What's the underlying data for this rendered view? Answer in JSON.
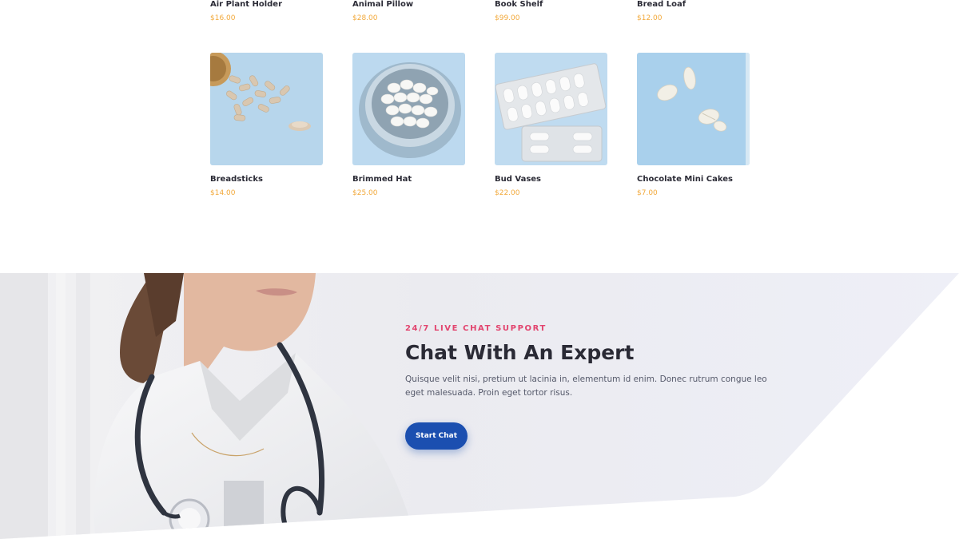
{
  "products": {
    "row_top": [
      {
        "name": "Air Plant Holder",
        "price": "$16.00"
      },
      {
        "name": "Animal Pillow",
        "price": "$28.00"
      },
      {
        "name": "Book Shelf",
        "price": "$99.00"
      },
      {
        "name": "Bread Loaf",
        "price": "$12.00"
      }
    ],
    "row_bottom": [
      {
        "name": "Breadsticks",
        "price": "$14.00"
      },
      {
        "name": "Brimmed Hat",
        "price": "$25.00"
      },
      {
        "name": "Bud Vases",
        "price": "$22.00"
      },
      {
        "name": "Chocolate Mini Cakes",
        "price": "$7.00"
      }
    ]
  },
  "chat": {
    "eyebrow": "24/7 LIVE CHAT SUPPORT",
    "title": "Chat With An Expert",
    "body": "Quisque velit nisi, pretium ut lacinia in, elementum id enim. Donec rutrum congue leo eget malesuada. Proin eget tortor risus.",
    "button_label": "Start Chat"
  },
  "colors": {
    "price": "#f2a93b",
    "eyebrow": "#e2456f",
    "button": "#1b4fb0",
    "heading": "#2a2a35",
    "image_bg": "#b9d8ee"
  }
}
